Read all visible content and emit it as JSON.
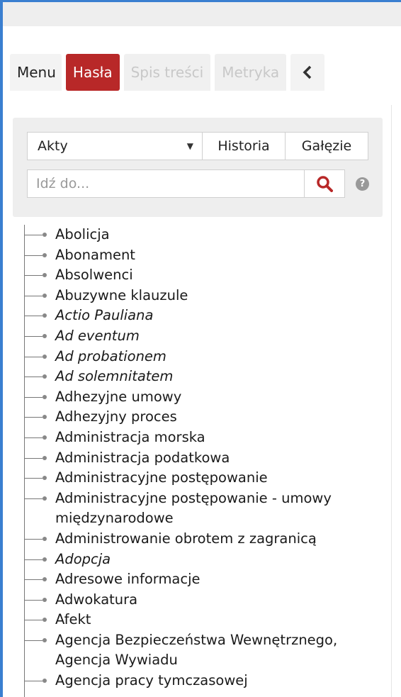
{
  "tabs": [
    {
      "label": "Menu",
      "state": "normal"
    },
    {
      "label": "Hasła",
      "state": "active"
    },
    {
      "label": "Spis treści",
      "state": "disabled"
    },
    {
      "label": "Metryka",
      "state": "disabled"
    }
  ],
  "back_icon": "chevron-left-icon",
  "filter": {
    "select_value": "Akty",
    "history_label": "Historia",
    "branches_label": "Gałęzie",
    "search_placeholder": "Idź do...",
    "search_icon": "magnifier-icon",
    "help_icon": "question-circle-icon"
  },
  "colors": {
    "accent": "#b82828",
    "frame": "#3a7fd0"
  },
  "entries": [
    {
      "label": "Abolicja",
      "italic": false
    },
    {
      "label": "Abonament",
      "italic": false
    },
    {
      "label": "Absolwenci",
      "italic": false
    },
    {
      "label": "Abuzywne klauzule",
      "italic": false
    },
    {
      "label": "Actio Pauliana",
      "italic": true
    },
    {
      "label": "Ad eventum",
      "italic": true
    },
    {
      "label": "Ad probationem",
      "italic": true
    },
    {
      "label": "Ad solemnitatem",
      "italic": true
    },
    {
      "label": "Adhezyjne umowy",
      "italic": false
    },
    {
      "label": "Adhezyjny proces",
      "italic": false
    },
    {
      "label": "Administracja morska",
      "italic": false
    },
    {
      "label": "Administracja podatkowa",
      "italic": false
    },
    {
      "label": "Administracyjne postępowanie",
      "italic": false
    },
    {
      "label": "Administracyjne postępowanie - umowy międzynarodowe",
      "italic": false
    },
    {
      "label": "Administrowanie obrotem z zagranicą",
      "italic": false
    },
    {
      "label": "Adopcja",
      "italic": true
    },
    {
      "label": "Adresowe informacje",
      "italic": false
    },
    {
      "label": "Adwokatura",
      "italic": false
    },
    {
      "label": "Afekt",
      "italic": false
    },
    {
      "label": "Agencja Bezpieczeństwa Wewnętrznego, Agencja Wywiadu",
      "italic": false
    },
    {
      "label": "Agencja pracy tymczasowej",
      "italic": false
    }
  ]
}
